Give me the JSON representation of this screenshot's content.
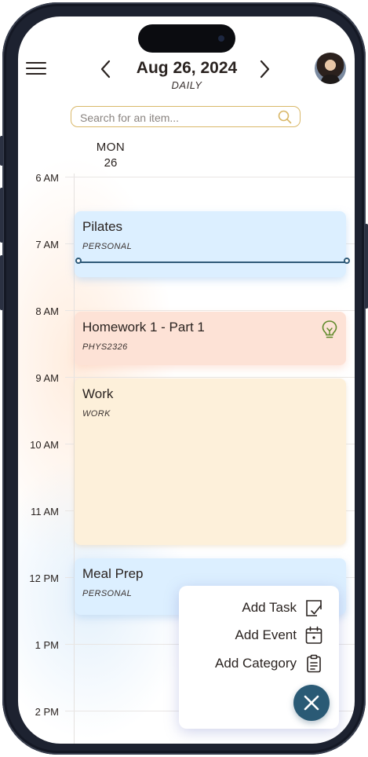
{
  "header": {
    "date_title": "Aug 26, 2024",
    "view_mode": "DAILY",
    "prev_icon": "chevron-left-icon",
    "next_icon": "chevron-right-icon",
    "menu_icon": "hamburger-menu-icon"
  },
  "search": {
    "placeholder": "Search for an item...",
    "value": ""
  },
  "day_column": {
    "day_name": "MON",
    "day_number": "26"
  },
  "hours": [
    "6 AM",
    "7 AM",
    "8 AM",
    "9 AM",
    "10 AM",
    "11 AM",
    "12 PM",
    "1 PM",
    "2 PM"
  ],
  "events": [
    {
      "name": "Pilates",
      "category": "PERSONAL",
      "color": "#dcefff"
    },
    {
      "name": "Homework 1 - Part 1",
      "category": "PHYS2326",
      "color": "#fde2d6",
      "icon": "lightbulb-icon"
    },
    {
      "name": "Work",
      "category": "WORK",
      "color": "#fdf0da"
    },
    {
      "name": "Meal Prep",
      "category": "PERSONAL",
      "color": "#dcefff"
    }
  ],
  "add_menu": {
    "add_task": "Add Task",
    "add_event": "Add Event",
    "add_category": "Add Category",
    "close_icon": "close-icon"
  },
  "colors": {
    "accent": "#2a5a75",
    "search_border": "#d9b869",
    "now_line": "#2f5a78"
  }
}
